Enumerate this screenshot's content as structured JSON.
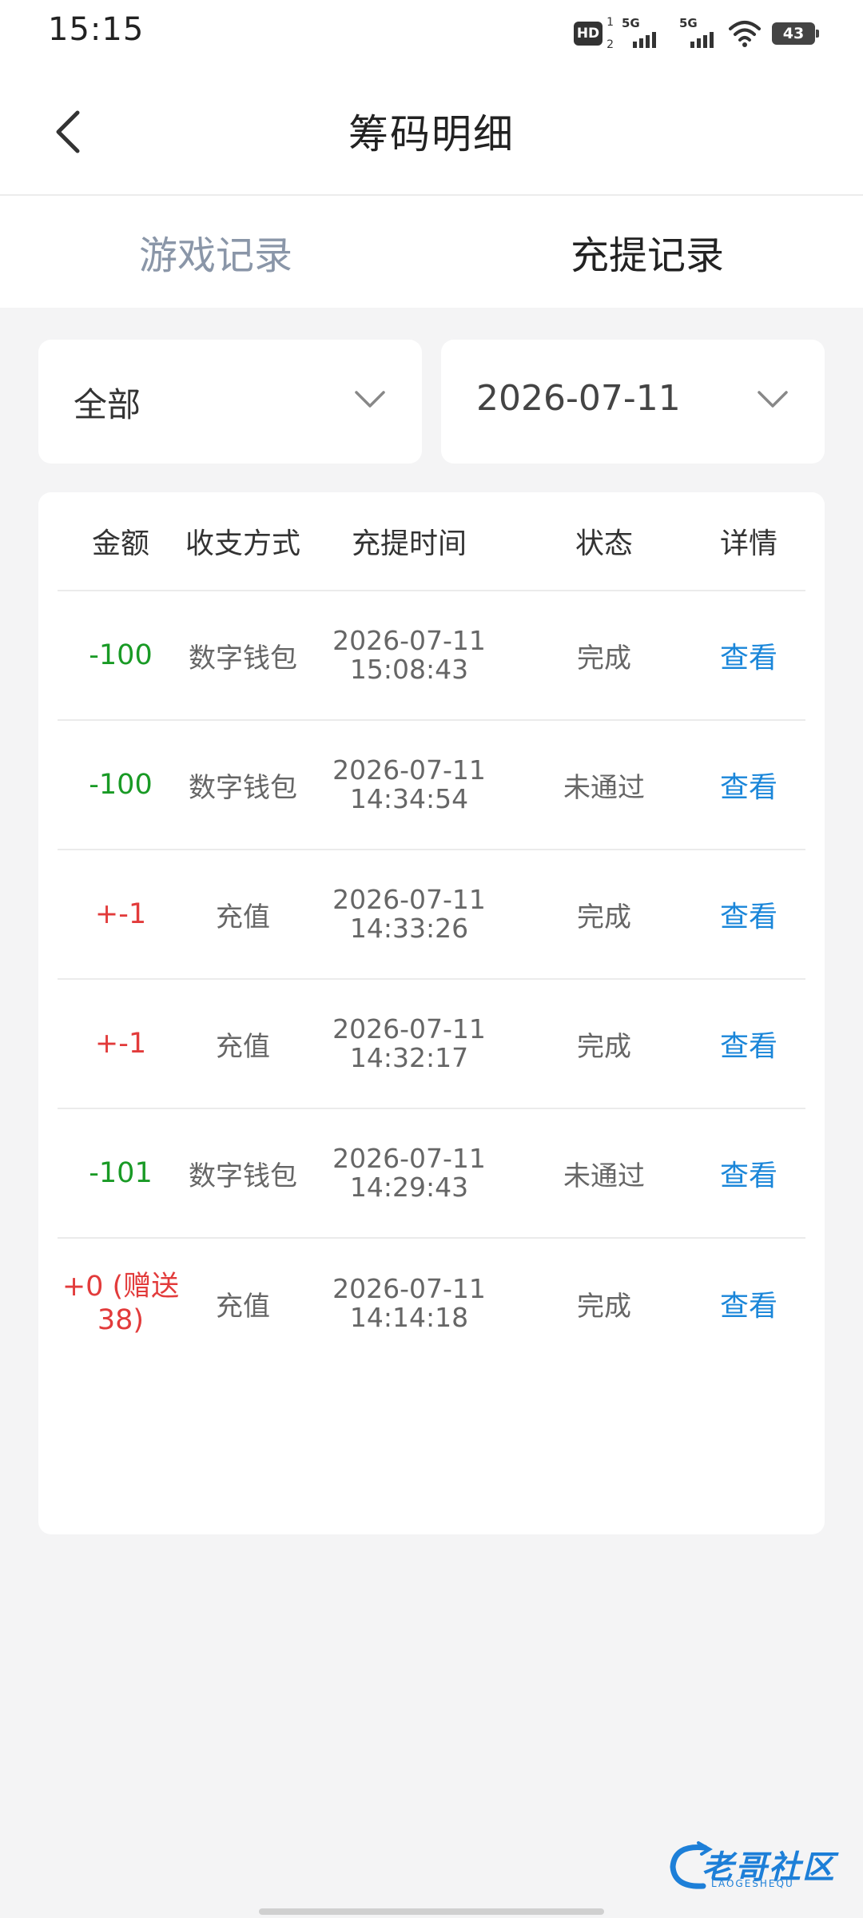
{
  "status_bar": {
    "time": "15:15",
    "hd_label": "HD",
    "hd_sup": "1",
    "hd_sub": "2",
    "signal1_label": "5G",
    "signal2_label": "5G",
    "battery": "43"
  },
  "header": {
    "title": "筹码明细",
    "back_icon": "chevron-left-icon"
  },
  "tabs": [
    {
      "label": "游戏记录",
      "active": false
    },
    {
      "label": "充提记录",
      "active": true
    }
  ],
  "filters": {
    "type": "全部",
    "date": "2026-07-11"
  },
  "table": {
    "headers": {
      "amount": "金额",
      "method": "收支方式",
      "time": "充提时间",
      "status": "状态",
      "detail": "详情"
    },
    "rows": [
      {
        "amount": "-100",
        "amount_type": "out",
        "method": "数字钱包",
        "date": "2026-07-11",
        "clock": "15:08:43",
        "status": "完成",
        "detail": "查看"
      },
      {
        "amount": "-100",
        "amount_type": "out",
        "method": "数字钱包",
        "date": "2026-07-11",
        "clock": "14:34:54",
        "status": "未通过",
        "detail": "查看"
      },
      {
        "amount": "+-1",
        "amount_type": "in",
        "method": "充值",
        "date": "2026-07-11",
        "clock": "14:33:26",
        "status": "完成",
        "detail": "查看"
      },
      {
        "amount": "+-1",
        "amount_type": "in",
        "method": "充值",
        "date": "2026-07-11",
        "clock": "14:32:17",
        "status": "完成",
        "detail": "查看"
      },
      {
        "amount": "-101",
        "amount_type": "out",
        "method": "数字钱包",
        "date": "2026-07-11",
        "clock": "14:29:43",
        "status": "未通过",
        "detail": "查看"
      },
      {
        "amount": "+0 (赠送38)",
        "amount_line1": "+0 (赠送",
        "amount_line2": "38)",
        "amount_type": "in",
        "method": "充值",
        "date": "2026-07-11",
        "clock": "14:14:18",
        "status": "完成",
        "detail": "查看"
      }
    ]
  },
  "colors": {
    "negative_amount": "#199a25",
    "positive_amount": "#e23b3b",
    "link": "#1a86d9",
    "tab_inactive": "#8a96a8"
  },
  "watermark": {
    "text": "老哥社区",
    "sub": "LAOGESHEQU"
  }
}
